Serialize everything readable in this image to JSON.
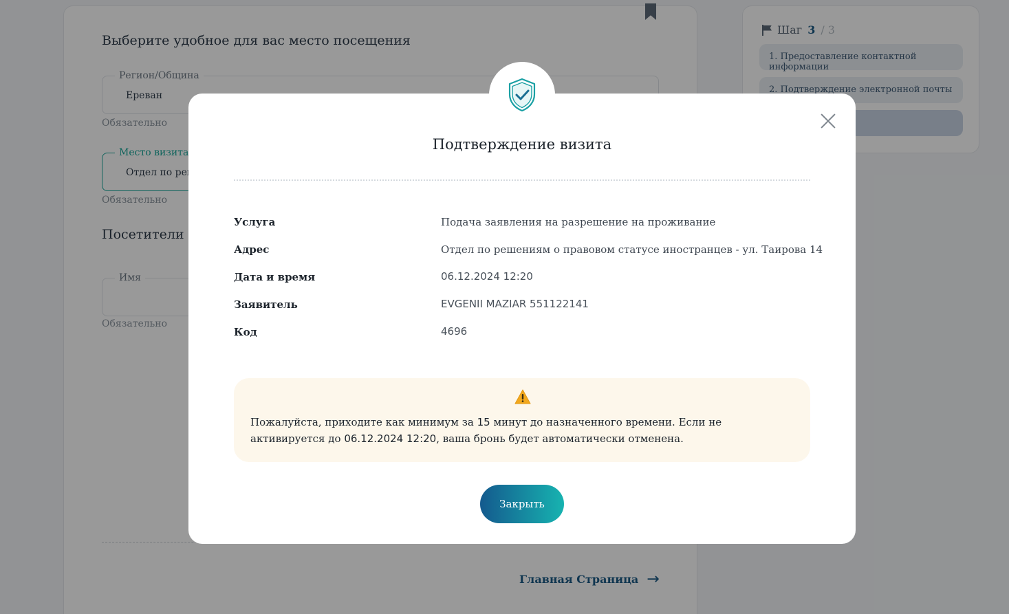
{
  "background": {
    "section_title": "Выберите удобное для вас место посещения",
    "region_label": "Регион/Община",
    "region_value": "Ереван",
    "region_helper": "Обязательно",
    "visit_place_label": "Место визита",
    "visit_place_value": "Отдел по решениям о правовом статусе иностранцев - ул. Таирова 14",
    "visit_place_helper": "Обязательно",
    "visitors_title": "Посетители",
    "name_label": "Имя",
    "name_value": "",
    "name_helper": "Обязательно",
    "home_link": "Главная Страница",
    "steps": {
      "prefix": "Шаг",
      "current": "3",
      "sep_total": "/ 3",
      "items": [
        "1. Предоставление контактной информации",
        "2. Подтверждение электронной почты",
        ""
      ]
    }
  },
  "modal": {
    "title": "Подтверждение визита",
    "rows": [
      {
        "label": "Услуга",
        "value": "Подача заявления на разрешение на проживание"
      },
      {
        "label": "Адрес",
        "value": "Отдел по решениям о правовом статусе иностранцев - ул. Таирова 14"
      },
      {
        "label": "Дата и время",
        "value": "06.12.2024 12:20"
      },
      {
        "label": "Заявитель",
        "value": "EVGENII MAZIAR 551122141"
      },
      {
        "label": "Код",
        "value": "4696"
      }
    ],
    "warning": {
      "icon": "warning-icon",
      "text_part1": "Пожалуйста, приходите как минимум за ",
      "minutes": "15",
      "text_part2": " минут до назначенного времени. Если не активируется до ",
      "datetime": "06.12.2024 12:20",
      "text_part3": ", ваша бронь будет автоматически отменена."
    },
    "close_button": "Закрыть"
  },
  "colors": {
    "accent_teal": "#17b3b0",
    "accent_blue": "#145a8e",
    "warning_bg": "#fdf7eb",
    "warning_icon": "#f2a81d"
  }
}
